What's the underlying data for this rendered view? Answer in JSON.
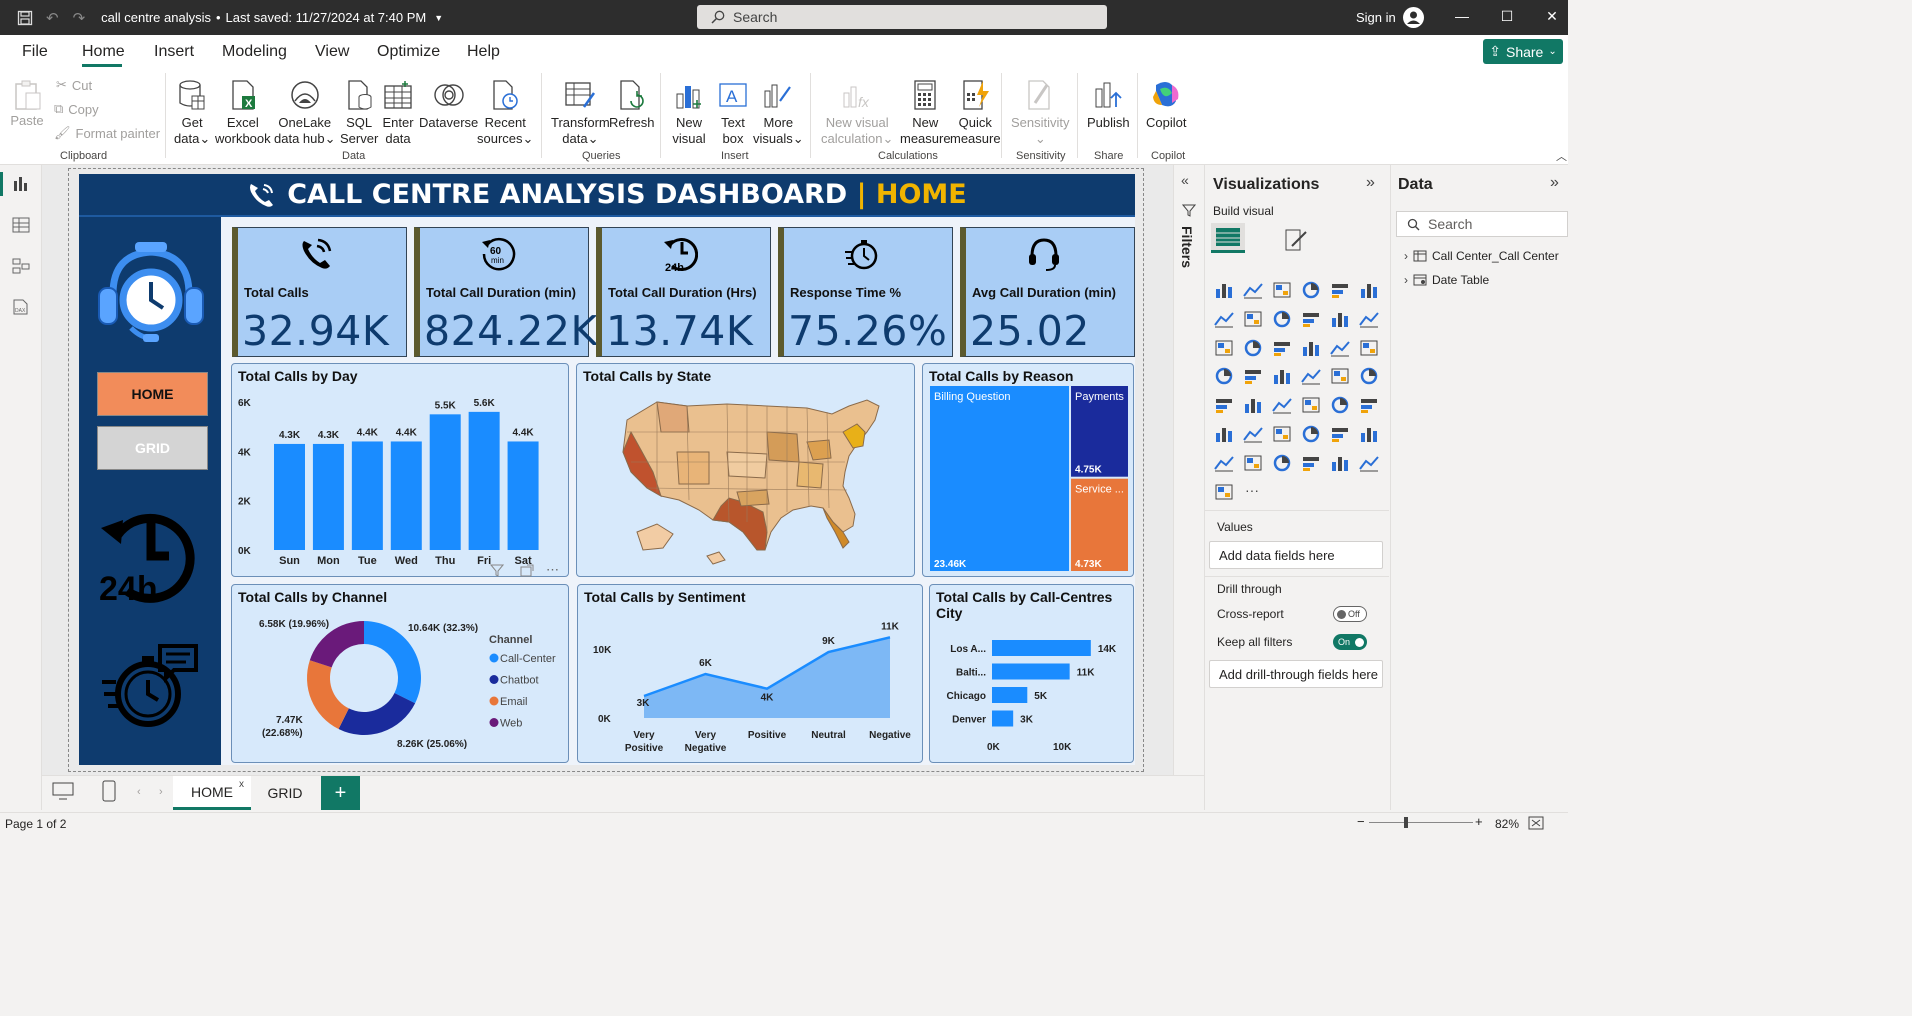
{
  "titlebar": {
    "file_name": "call centre analysis",
    "save_status": "Last saved: 11/27/2024 at 7:40 PM",
    "search_placeholder": "Search",
    "signin": "Sign in"
  },
  "menu": {
    "items": [
      "File",
      "Home",
      "Insert",
      "Modeling",
      "View",
      "Optimize",
      "Help"
    ],
    "active": "Home",
    "share": "Share"
  },
  "ribbon": {
    "clipboard": {
      "paste": "Paste",
      "cut": "Cut",
      "copy": "Copy",
      "format_painter": "Format painter",
      "group": "Clipboard"
    },
    "data": {
      "get_data": [
        "Get",
        "data"
      ],
      "excel": [
        "Excel",
        "workbook"
      ],
      "onelake": [
        "OneLake",
        "data hub"
      ],
      "sql": [
        "SQL",
        "Server"
      ],
      "enter": [
        "Enter",
        "data"
      ],
      "dataverse": "Dataverse",
      "recent": [
        "Recent",
        "sources"
      ],
      "group": "Data"
    },
    "queries": {
      "transform": [
        "Transform",
        "data"
      ],
      "refresh": "Refresh",
      "group": "Queries"
    },
    "insert": {
      "new_visual": [
        "New",
        "visual"
      ],
      "text_box": [
        "Text",
        "box"
      ],
      "more_visuals": [
        "More",
        "visuals"
      ],
      "group": "Insert"
    },
    "calculations": {
      "new_visual_calc": [
        "New visual",
        "calculation"
      ],
      "new_measure": [
        "New",
        "measure"
      ],
      "quick_measure": [
        "Quick",
        "measure"
      ],
      "group": "Calculations"
    },
    "sensitivity": {
      "label": "Sensitivity",
      "group": "Sensitivity"
    },
    "share": {
      "publish": "Publish",
      "group": "Share"
    },
    "copilot": {
      "label": "Copilot",
      "group": "Copilot"
    }
  },
  "report": {
    "title_main": "CALL CENTRE ANALYSIS DASHBOARD",
    "title_sep": " | ",
    "title_page": "HOME",
    "nav": {
      "home": "HOME",
      "grid": "GRID"
    },
    "kpis": [
      {
        "label": "Total Calls",
        "value": "32.94K",
        "icon": "phone-ringing-icon"
      },
      {
        "label": "Total Call Duration (min)",
        "value": "824.22K",
        "icon": "timer-60-min-icon"
      },
      {
        "label": "Total Call Duration (Hrs)",
        "value": "13.74K",
        "icon": "clock-24h-icon"
      },
      {
        "label": "Response Time %",
        "value": "75.26%",
        "icon": "stopwatch-icon"
      },
      {
        "label": "Avg Call Duration (min)",
        "value": "25.02",
        "icon": "headset-icon"
      }
    ]
  },
  "colors": {
    "navy": "#0e3b6e",
    "bar_blue": "#1a8cff",
    "kpi_bg": "#a9cdf5",
    "panel_bg": "#d7e9fb",
    "home_btn": "#f28c5a",
    "grid_btn": "#d4d4d4",
    "accent_yellow": "#f0b400",
    "brand_green": "#117865"
  },
  "chart_data": [
    {
      "id": "calls_by_day",
      "type": "bar",
      "title": "Total Calls by Day",
      "categories": [
        "Sun",
        "Mon",
        "Tue",
        "Wed",
        "Thu",
        "Fri",
        "Sat"
      ],
      "values": [
        4300,
        4300,
        4400,
        4400,
        5500,
        5600,
        4400
      ],
      "data_labels": [
        "4.3K",
        "4.3K",
        "4.4K",
        "4.4K",
        "5.5K",
        "5.6K",
        "4.4K"
      ],
      "yticks": [
        "0K",
        "2K",
        "4K",
        "6K"
      ],
      "ylim": [
        0,
        6000
      ]
    },
    {
      "id": "calls_by_state",
      "type": "map",
      "title": "Total Calls by State"
    },
    {
      "id": "calls_by_reason",
      "type": "treemap",
      "title": "Total Calls by Reason",
      "items": [
        {
          "name": "Billing Question",
          "value": 23460,
          "label": "23.46K"
        },
        {
          "name": "Payments",
          "value": 4750,
          "label": "4.75K"
        },
        {
          "name": "Service ...",
          "value": 4730,
          "label": "4.73K"
        }
      ]
    },
    {
      "id": "calls_by_channel",
      "type": "pie",
      "title": "Total Calls by Channel",
      "legend_title": "Channel",
      "slices": [
        {
          "name": "Call-Center",
          "value": 10640,
          "label": "10.64K (32.3%)",
          "color": "#1a8cff"
        },
        {
          "name": "Chatbot",
          "value": 8260,
          "label": "8.26K (25.06%)",
          "color": "#1a2b9c"
        },
        {
          "name": "Email",
          "value": 7470,
          "label_lines": [
            "7.47K",
            "(22.68%)"
          ],
          "color": "#e8763a"
        },
        {
          "name": "Web",
          "value": 6580,
          "label": "6.58K (19.96%)",
          "color": "#6a1a7a"
        }
      ]
    },
    {
      "id": "calls_by_sentiment",
      "type": "area",
      "title": "Total Calls by Sentiment",
      "categories": [
        [
          "Very",
          "Positive"
        ],
        [
          "Very",
          "Negative"
        ],
        [
          "Positive"
        ],
        [
          "Neutral"
        ],
        [
          "Negative"
        ]
      ],
      "values": [
        3000,
        6000,
        4000,
        9000,
        11000
      ],
      "data_labels": [
        "3K",
        "6K",
        "4K",
        "9K",
        "11K"
      ],
      "yticks": [
        "0K",
        "10K"
      ],
      "ylim": [
        0,
        12000
      ]
    },
    {
      "id": "calls_by_city",
      "type": "bar",
      "orientation": "horizontal",
      "title": "Total Calls by Call-Centres City",
      "categories": [
        "Los A...",
        "Balti...",
        "Chicago",
        "Denver"
      ],
      "values": [
        14000,
        11000,
        5000,
        3000
      ],
      "data_labels": [
        "14K",
        "11K",
        "5K",
        "3K"
      ],
      "xticks": [
        "0K",
        "10K"
      ],
      "xlim": [
        0,
        17000
      ]
    }
  ],
  "tabs": [
    {
      "label": "HOME",
      "active": true
    },
    {
      "label": "GRID",
      "active": false
    }
  ],
  "status": {
    "page": "Page 1 of 2",
    "zoom": "82%"
  },
  "panes": {
    "filters": "Filters",
    "visualizations": "Visualizations",
    "build_visual": "Build visual",
    "values": "Values",
    "add_data_fields": "Add data fields here",
    "drill_through": "Drill through",
    "cross_report": "Cross-report",
    "cross_report_state": "Off",
    "keep_filters": "Keep all filters",
    "keep_filters_state": "On",
    "add_drill_fields": "Add drill-through fields here",
    "data": "Data",
    "data_search": "Search",
    "tables": [
      "Call Center_Call Center",
      "Date Table"
    ]
  }
}
